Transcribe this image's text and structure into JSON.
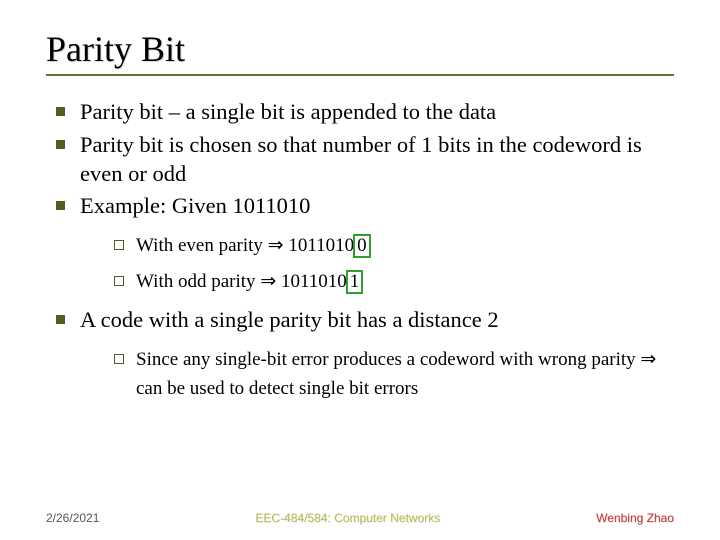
{
  "title": "Parity Bit",
  "bullets": {
    "b1": "Parity bit – a single bit is appended to the data",
    "b2": "Parity bit is chosen so that number of 1 bits in the codeword is even or odd",
    "b3": "Example: Given 1011010",
    "b3_sub1_pre": "With even parity ",
    "b3_sub1_code": " 1011010",
    "b3_sub1_box": "0",
    "b3_sub2_pre": "With odd parity ",
    "b3_sub2_code": " 1011010",
    "b3_sub2_box": "1",
    "b4": "A code with a single parity bit has a distance 2",
    "b4_sub1_pre": "Since any single-bit error produces a codeword with wrong parity ",
    "b4_sub1_post": " can be used to detect single bit errors"
  },
  "implies_glyph": "⇒",
  "footer": {
    "date": "2/26/2021",
    "center": "EEC-484/584: Computer Networks",
    "author": "Wenbing Zhao"
  }
}
